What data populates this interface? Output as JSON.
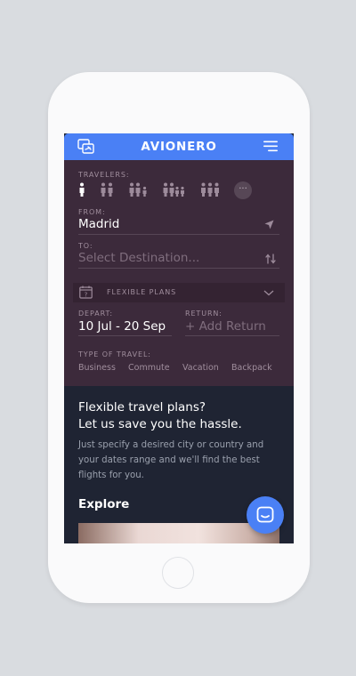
{
  "app": {
    "brand": "AVIONERO"
  },
  "travelers": {
    "label": "TRAVELERS:",
    "options": [
      "1 traveler",
      "2 travelers",
      "3 travelers",
      "4 travelers",
      "5 travelers"
    ],
    "selected": 0,
    "more": "···"
  },
  "from": {
    "label": "FROM:",
    "value": "Madrid"
  },
  "to": {
    "label": "TO:",
    "placeholder": "Select Destination..."
  },
  "flexible": {
    "label": "FLEXIBLE PLANS",
    "calendar_day": "?"
  },
  "depart": {
    "label": "DEPART:",
    "value": "10 Jul - 20 Sep"
  },
  "return": {
    "label": "RETURN:",
    "placeholder": "+ Add Return"
  },
  "travel_type": {
    "label": "TYPE OF TRAVEL:",
    "options": [
      "Business",
      "Commute",
      "Vacation",
      "Backpack"
    ]
  },
  "promo": {
    "heading_line1": "Flexible travel plans?",
    "heading_line2": "Let us save you the hassle.",
    "body_line1": "Just specify a desired city or country and",
    "body_line2": "your dates range and we'll find the best",
    "body_line3": "flights for you."
  },
  "explore": {
    "title": "Explore"
  },
  "colors": {
    "accent": "#4a80f5",
    "form_bg": "#3c2a3b",
    "promo_bg": "#1f2433",
    "page_bg": "#d9dce0"
  }
}
